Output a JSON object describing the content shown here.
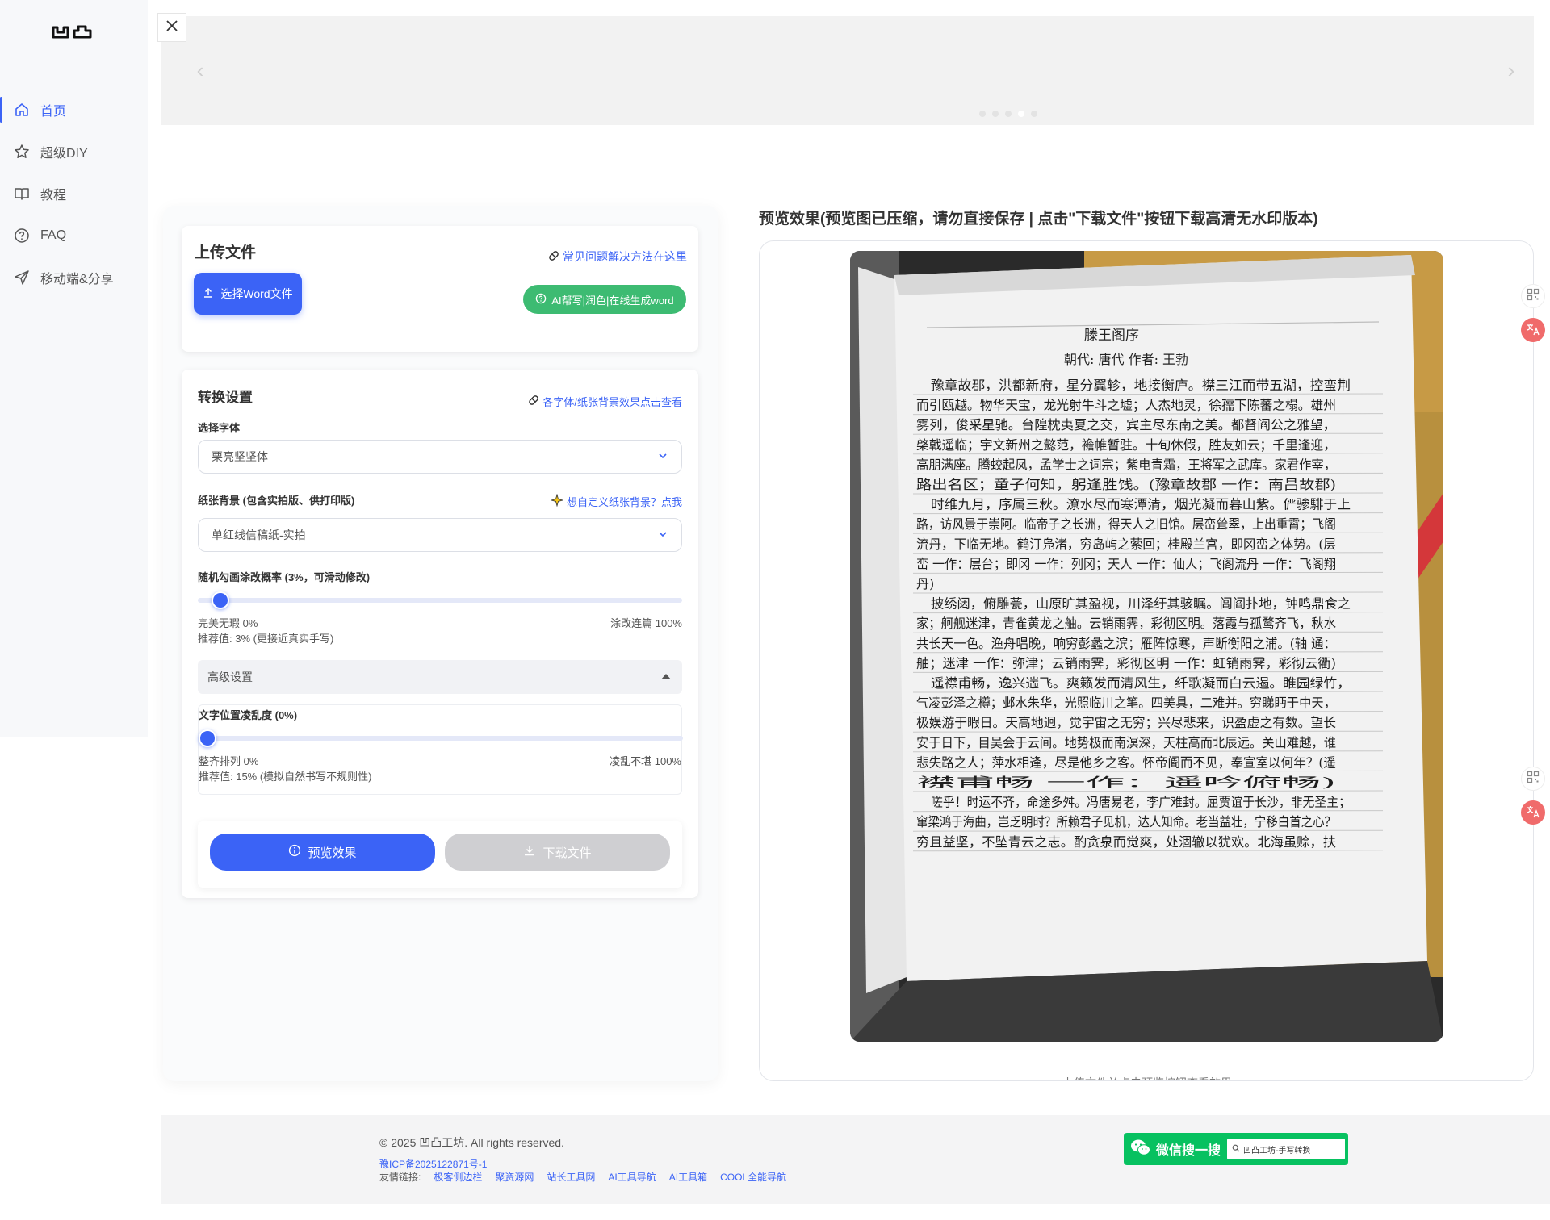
{
  "sidebar": {
    "items": [
      {
        "label": "首页",
        "icon": "home-icon",
        "active": true
      },
      {
        "label": "超级DIY",
        "icon": "star-icon",
        "active": false
      },
      {
        "label": "教程",
        "icon": "book-icon",
        "active": false
      },
      {
        "label": "FAQ",
        "icon": "question-circle-icon",
        "active": false
      },
      {
        "label": "移动端&分享",
        "icon": "send-icon",
        "active": false
      }
    ]
  },
  "upload": {
    "title": "上传文件",
    "help_link": "常见问题解决方法在这里",
    "select_button": "选择Word文件",
    "ai_button": "AI帮写|润色|在线生成word"
  },
  "settings": {
    "title": "转换设置",
    "font_help_link": "各字体/纸张背景效果点击查看",
    "font_label": "选择字体",
    "font_value": "栗亮坚坚体",
    "paper_label": "纸张背景 (包含实拍版、供打印版)",
    "paper_custom_link": "想自定义纸张背景？点我",
    "paper_value": "单红线信稿纸-实拍",
    "scribble_label": "随机勾画涂改概率 (3%，可滑动修改)",
    "scribble_value": 0.03,
    "scribble_min": "完美无瑕 0%",
    "scribble_max": "涂改连篇 100%",
    "scribble_hint": "推荐值: 3% (更接近真实手写)",
    "advanced_label": "高级设置",
    "jitter_label": "文字位置凌乱度 (0%)",
    "jitter_value": 0.0,
    "jitter_min": "整齐排列 0%",
    "jitter_max": "凌乱不堪 100%",
    "jitter_hint": "推荐值: 15% (模拟自然书写不规则性)",
    "preview_button": "预览效果",
    "download_button": "下载文件"
  },
  "preview": {
    "title": "预览效果(预览图已压缩，请勿直接保存 | 点击\"下载文件\"按钮下载高清无水印版本)",
    "caption": "上传文件并点击预览按钮查看效果",
    "doc_title": "滕王阁序",
    "doc_subtitle": "朝代: 唐代 作者: 王勃",
    "doc_lines": [
      "豫章故郡，洪都新府，星分翼轸，地接衡庐。襟三江而带五湖，控蛮荆",
      "而引瓯越。物华天宝，龙光射牛斗之墟；人杰地灵，徐孺下陈蕃之榻。雄州",
      "雾列，俊采星驰。台隍枕夷夏之交，宾主尽东南之美。都督阎公之雅望，",
      "棨戟遥临；宇文新州之懿范，襜帷暂驻。十旬休假，胜友如云；千里逢迎，",
      "高朋满座。腾蛟起凤，孟学士之词宗；紫电青霜，王将军之武库。家君作宰，",
      "路出名区；童子何知，躬逢胜饯。(豫章故郡 一作：南昌故郡)",
      "时维九月，序属三秋。潦水尽而寒潭清，烟光凝而暮山紫。俨骖騑于上",
      "路，访风景于崇阿。临帝子之长洲，得天人之旧馆。层峦耸翠，上出重霄；飞阁",
      "流丹，下临无地。鹤汀凫渚，穷岛屿之萦回；桂殿兰宫，即冈峦之体势。(层",
      "峦 一作：层台；即冈 一作：列冈；天人 一作：仙人；飞阁流丹 一作：飞阁翔",
      "丹)",
      "披绣闼，俯雕甍，山原旷其盈视，川泽纡其骇瞩。闾阎扑地，钟鸣鼎食之",
      "家；舸舰迷津，青雀黄龙之舳。云销雨霁，彩彻区明。落霞与孤鹜齐飞，秋水",
      "共长天一色。渔舟唱晚，响穷彭蠡之滨；雁阵惊寒，声断衡阳之浦。(轴 通：",
      "舳；迷津 一作：弥津；云销雨霁，彩彻区明 一作：虹销雨霁，彩彻云衢)",
      "遥襟甫畅，逸兴遄飞。爽籁发而清风生，纤歌凝而白云遏。睢园绿竹，",
      "气凌彭泽之樽；邺水朱华，光照临川之笔。四美具，二难并。穷睇眄于中天，",
      "极娱游于暇日。天高地迥，觉宇宙之无穷；兴尽悲来，识盈虚之有数。望长",
      "安于日下，目吴会于云间。地势极而南溟深，天柱高而北辰远。关山难越，谁",
      "悲失路之人；萍水相逢，尽是他乡之客。怀帝阍而不见，奉宣室以何年？(遥",
      "襟甫畅 一作：遥吟俯畅)",
      "嗟乎！时运不齐，命途多舛。冯唐易老，李广难封。屈贾谊于长沙，非无圣主；",
      "窜梁鸿于海曲，岂乏明时？所赖君子见机，达人知命。老当益壮，宁移白首之心？",
      "穷且益坚，不坠青云之志。酌贪泉而觉爽，处涸辙以犹欢。北海虽赊，扶"
    ]
  },
  "footer": {
    "copyright": "© 2025 凹凸工坊. All rights reserved.",
    "icp": "豫ICP备2025122871号-1",
    "links_label": "友情链接:",
    "links": [
      "极客侧边栏",
      "聚资源网",
      "站长工具网",
      "AI工具导航",
      "AI工具箱",
      "COOL全能导航"
    ],
    "wechat_text": "微信搜一搜",
    "wechat_query": "凹凸工坊-手写转换"
  },
  "colors": {
    "accent": "#3b63f6",
    "green": "#3dbb72",
    "wechat": "#07c160"
  }
}
